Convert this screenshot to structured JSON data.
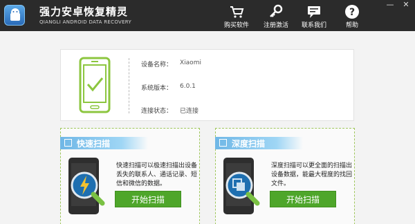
{
  "app": {
    "title": "强力安卓恢复精灵",
    "subtitle": "QIANGLI ANDROID DATA RECOVERY"
  },
  "toolbar": {
    "buy": "购买软件",
    "register": "注册激活",
    "contact": "联系我们",
    "help": "帮助"
  },
  "window": {
    "minimize": "—",
    "close": "✕"
  },
  "device": {
    "name_label": "设备名称：",
    "name_value": "Xiaomi",
    "version_label": "系统版本：",
    "version_value": "6.0.1",
    "status_label": "连接状态：",
    "status_value": "已连接"
  },
  "quick_scan": {
    "title": "快速扫描",
    "desc": "快速扫描可以极速扫描出设备丢失的联系人、通话记录、短信和微信的数据。",
    "button": "开始扫描"
  },
  "deep_scan": {
    "title": "深度扫描",
    "desc": "深度扫描可以更全面的扫描出设备数据，能最大程度的找回文件。",
    "button": "开始扫描"
  },
  "colors": {
    "accent_green": "#4ea62a",
    "header_blue": "#6fb7e6",
    "titlebar": "#2b2b2b"
  }
}
